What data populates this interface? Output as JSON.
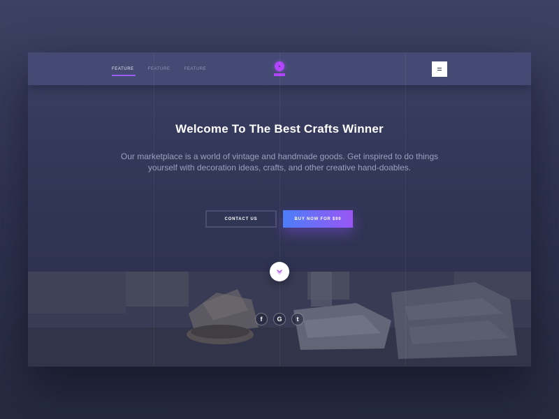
{
  "nav": {
    "links": [
      "FEATURE",
      "FEATURE",
      "FEATURE"
    ],
    "active_index": 0,
    "logo_icon": "circle-logo-icon",
    "menu_icon": "hamburger-menu-icon"
  },
  "hero": {
    "title": "Welcome To The Best Crafts Winner",
    "description": "Our marketplace is a world of vintage and handmade goods. Get inspired to do things yourself with decoration ideas, crafts, and other creative hand-doables."
  },
  "buttons": {
    "contact_label": "CONTACT US",
    "buy_label": "BUY NOW FOR $99"
  },
  "scroll_icon": "chevron-down-icon",
  "social": [
    {
      "icon": "facebook-icon",
      "glyph": "f"
    },
    {
      "icon": "google-icon",
      "glyph": "G"
    },
    {
      "icon": "twitter-icon",
      "glyph": "t"
    }
  ],
  "colors": {
    "accent": "#9b5cf5",
    "logo": "#b145ff",
    "buy_gradient_start": "#4b7ef9",
    "buy_gradient_end": "#9a56f5",
    "nav_background": "#454a74",
    "page_background": "#2f3350"
  }
}
